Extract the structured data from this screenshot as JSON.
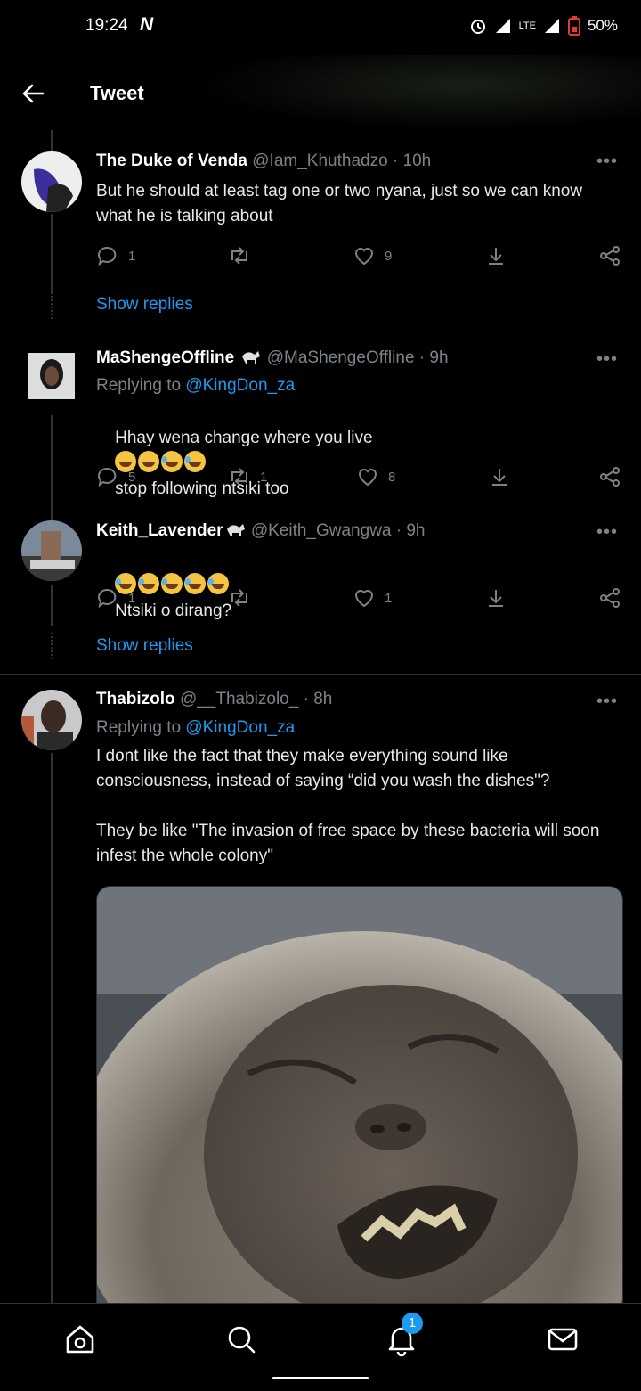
{
  "status_bar": {
    "time": "19:24",
    "carrier_logo": "N",
    "network": "LTE",
    "battery": "50%"
  },
  "header": {
    "title": "Tweet"
  },
  "tweets": [
    {
      "name": "The Duke of Venda",
      "handle": "@Iam_Khuthadzo · 10h",
      "body": "But he should at least tag one or two nyana, just so we can know what he is talking about",
      "replies": "1",
      "retweets": "",
      "likes": "9",
      "show_replies": "Show replies"
    },
    {
      "name": "MaShengeOffline",
      "handle": "@MaShengeOffline · 9h",
      "replying_prefix": "Replying to",
      "replying_to": "@KingDon_za",
      "body_before": "Hhay wena change where you live",
      "body_after": "stop following ntsiki too",
      "replies": "5",
      "retweets": "1",
      "likes": "8"
    },
    {
      "name": "Keith_Lavender",
      "handle": "@Keith_Gwangwa · 9h",
      "body": "Ntsiki o dirang?",
      "replies": "1",
      "retweets": "",
      "likes": "1",
      "show_replies": "Show replies"
    },
    {
      "name": "Thabizolo",
      "handle": "@__Thabizolo_ · 8h",
      "replying_prefix": "Replying to",
      "replying_to": "@KingDon_za",
      "body": "I dont like the fact that they make everything sound like consciousness, instead of saying “did you wash the dishes\"?\n\nThey be like \"The invasion of free space by these bacteria will soon infest the whole colony\""
    }
  ],
  "bottom_nav": {
    "notifications_badge": "1"
  },
  "colors": {
    "accent": "#1d9bf0",
    "muted": "#7c8388",
    "background": "#000000"
  }
}
